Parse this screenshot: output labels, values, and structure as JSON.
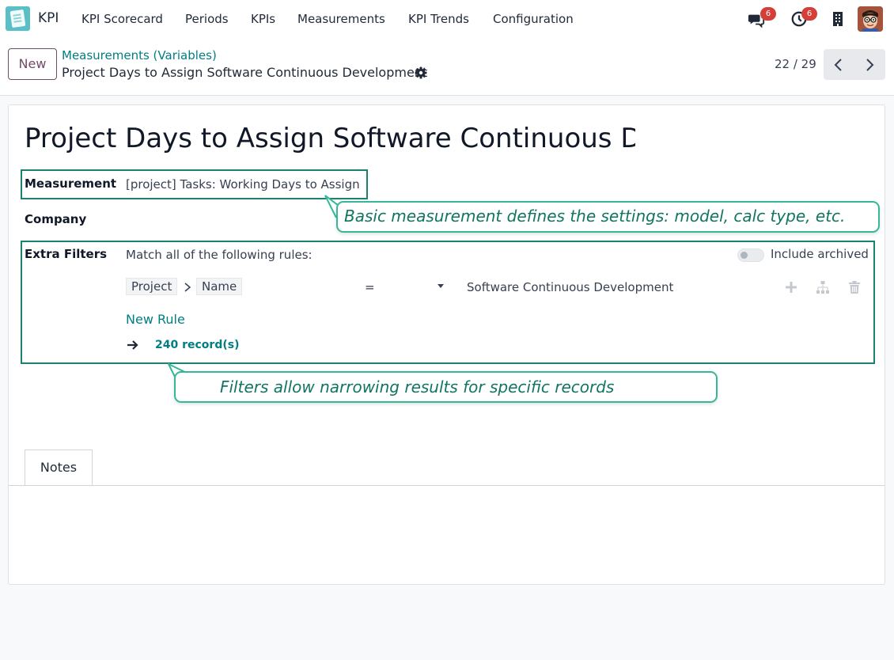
{
  "navbar": {
    "app_name": "KPI",
    "menu": [
      "KPI Scorecard",
      "Periods",
      "KPIs",
      "Measurements",
      "KPI Trends",
      "Configuration"
    ],
    "icons": [
      "chat-icon",
      "clock-icon",
      "building-icon"
    ],
    "messages_count": "6",
    "activities_count": "6"
  },
  "control_panel": {
    "new_label": "New",
    "breadcrumb_parent": "Measurements (Variables)",
    "breadcrumb_current": "Project Days to Assign Software Continuous Development",
    "pager": "22 / 29"
  },
  "form": {
    "title": "Project Days to Assign Software Continuous Development",
    "measurement_label": "Measurement",
    "measurement_value": "[project] Tasks: Working Days to Assign",
    "company_label": "Company",
    "extra_filters_label": "Extra Filters",
    "match_text": "Match all of the following rules:",
    "include_archived": "Include archived",
    "rule": {
      "path": [
        "Project",
        "Name"
      ],
      "operator": "=",
      "value": "Software Continuous Development"
    },
    "new_rule": "New Rule",
    "records": "240 record(s)"
  },
  "callouts": {
    "measurement": "Basic measurement defines the settings: model, calc type, etc.",
    "filters": "Filters allow narrowing results for specific records"
  },
  "tabs": [
    "Notes"
  ],
  "colors": {
    "brand": "#714b67",
    "link": "#017e84",
    "callout_border": "#35b89a",
    "highlight_border": "#1a8370",
    "badge": "#d43f3a"
  }
}
